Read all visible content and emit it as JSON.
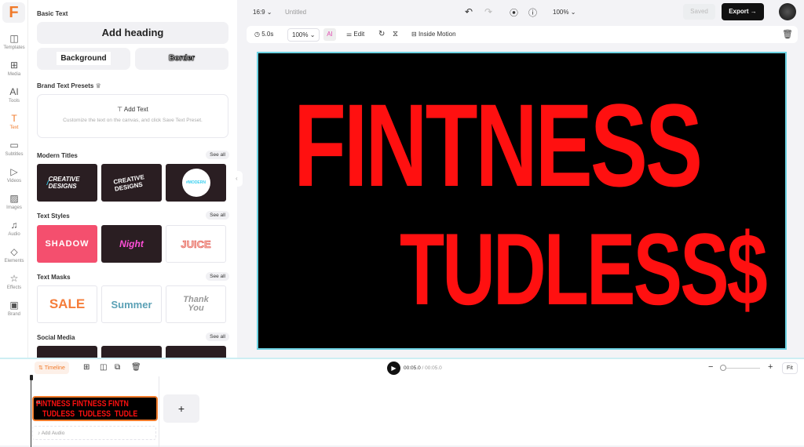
{
  "sidebar": {
    "items": [
      {
        "label": "Templates",
        "icon": "templates-icon"
      },
      {
        "label": "Media",
        "icon": "media-icon"
      },
      {
        "label": "Tools",
        "icon": "ai-tools-icon"
      },
      {
        "label": "Text",
        "icon": "text-icon"
      },
      {
        "label": "Subtitles",
        "icon": "subtitles-icon"
      },
      {
        "label": "Videos",
        "icon": "videos-icon"
      },
      {
        "label": "Images",
        "icon": "images-icon"
      },
      {
        "label": "Audio",
        "icon": "audio-icon"
      },
      {
        "label": "Elements",
        "icon": "elements-icon"
      },
      {
        "label": "Effects",
        "icon": "effects-icon"
      },
      {
        "label": "Brand",
        "icon": "brand-icon"
      }
    ],
    "active": "Text"
  },
  "panel": {
    "basic_text": "Basic Text",
    "add_heading": "Add heading",
    "background": "Background",
    "border": "Border",
    "brand_presets": "Brand Text Presets",
    "add_text": "Add Text",
    "preset_hint": "Customize the text on the canvas, and click Save Text Preset.",
    "see_all": "See all",
    "sections": [
      {
        "title": "Modern Titles",
        "thumbs": [
          "CREATIVE DESIGNS",
          "CREATIVE DESIGNS",
          "#MODERN"
        ]
      },
      {
        "title": "Text Styles",
        "thumbs": [
          "SHADOW",
          "Night",
          "JUICE"
        ]
      },
      {
        "title": "Text Masks",
        "thumbs": [
          "SALE",
          "Summer",
          "Thank You"
        ]
      },
      {
        "title": "Social Media",
        "thumbs": [
          "",
          "",
          ""
        ]
      }
    ]
  },
  "header": {
    "ratio": "16:9",
    "title": "Untitled",
    "zoom": "100%",
    "saved": "Saved",
    "export": "Export"
  },
  "toolbar": {
    "duration": "5.0s",
    "scale": "100%",
    "edit": "Edit",
    "inside_motion": "Inside Motion"
  },
  "canvas": {
    "line1": "FINTNESS",
    "line2": "TUDLESS$",
    "bg": "#000000",
    "text_color": "#ff1010"
  },
  "timeline": {
    "label": "Timeline",
    "current": "00:05.0",
    "total": "/ 00:05.0",
    "fit": "Fit",
    "clip_index": "01",
    "add_audio": "Add Audio",
    "clip_text1": "FINTNESS FINTNESS FINTN",
    "clip_text2": "TUDLESS  TUDLESS  TUDLE"
  },
  "colors": {
    "accent": "#f07a2a",
    "selection": "#6dd3e3"
  }
}
